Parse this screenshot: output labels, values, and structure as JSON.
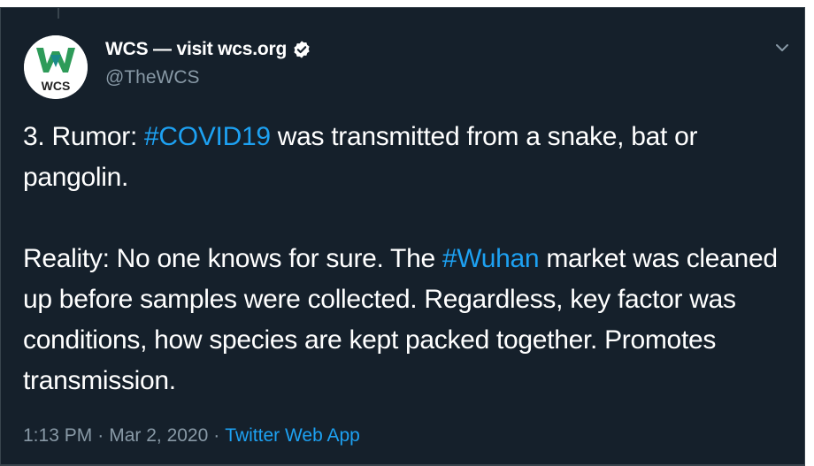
{
  "tweet": {
    "author": {
      "display_name": "WCS — visit wcs.org",
      "handle": "@TheWCS",
      "avatar_text": "WCS",
      "verified": true
    },
    "text": {
      "line1_prefix": "3. Rumor: ",
      "hashtag1": "#COVID19",
      "line1_suffix": " was transmitted from a snake, bat or pangolin.",
      "line2_prefix": "Reality: No one knows for sure. The ",
      "hashtag2": "#Wuhan",
      "line2_suffix": " market was cleaned up before samples were collected. Regardless, key factor was conditions, how species are kept packed together. Promotes transmission."
    },
    "time": "1:13 PM",
    "date": "Mar 2, 2020",
    "separator": "·",
    "source": "Twitter Web App"
  },
  "colors": {
    "background": "#15202b",
    "text": "#ffffff",
    "secondary": "#8899a6",
    "accent": "#1da1f2",
    "border": "#38444d",
    "logo_green": "#2e9b59",
    "logo_teal": "#1b8a8a"
  },
  "icons": {
    "verified": "verified-badge-icon",
    "menu": "chevron-down-icon",
    "avatar": "wcs-logo"
  }
}
